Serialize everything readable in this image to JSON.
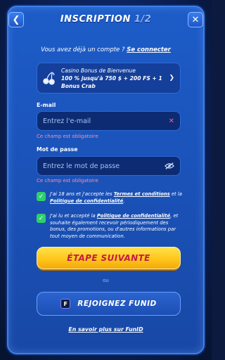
{
  "header": {
    "title": "INSCRIPTION",
    "step": "1/2",
    "back_icon": "chevron-left-icon",
    "close_icon": "close-icon"
  },
  "login": {
    "prompt": "Vous avez déjà un compte ?",
    "link": "Se connecter"
  },
  "bonus": {
    "icon": "cherry-icon",
    "title": "Casino Bonus de Bienvenue",
    "line1": "100 % jusqu'à 750 $ + 200 FS + 1",
    "line2": "Bonus Crab"
  },
  "email": {
    "label": "E-mail",
    "placeholder": "Entrez l'e-mail",
    "value": "",
    "error": "Ce champ est obligatoire"
  },
  "password": {
    "label": "Mot de passe",
    "placeholder": "Entrez le mot de passe",
    "value": "",
    "error": "Ce champ est obligatoire"
  },
  "terms": {
    "checked": true,
    "prefix": "J'ai 18 ans et j'accepte les",
    "link1": "Termes et conditions",
    "mid": "et la",
    "link2": "Politique de confidentialité",
    "suffix": "."
  },
  "marketing": {
    "checked": true,
    "prefix": "J'ai lu et accepté la",
    "link": "Politique de confidentialité",
    "rest": ", et souhaite également recevoir périodiquement des bonus, des promotions, ou d'autres informations par tout moyen de communication."
  },
  "next_button": "ÉTAPE SUIVANTE",
  "or_text": "ou",
  "funid_button": "REJOIGNEZ FUNID",
  "more_link": "En savoir plus sur FunID",
  "colors": {
    "accent_yellow": "#ffc61a",
    "cta_text": "#c21a4a",
    "check_green": "#2fd06b",
    "error": "#ff8fa8"
  }
}
